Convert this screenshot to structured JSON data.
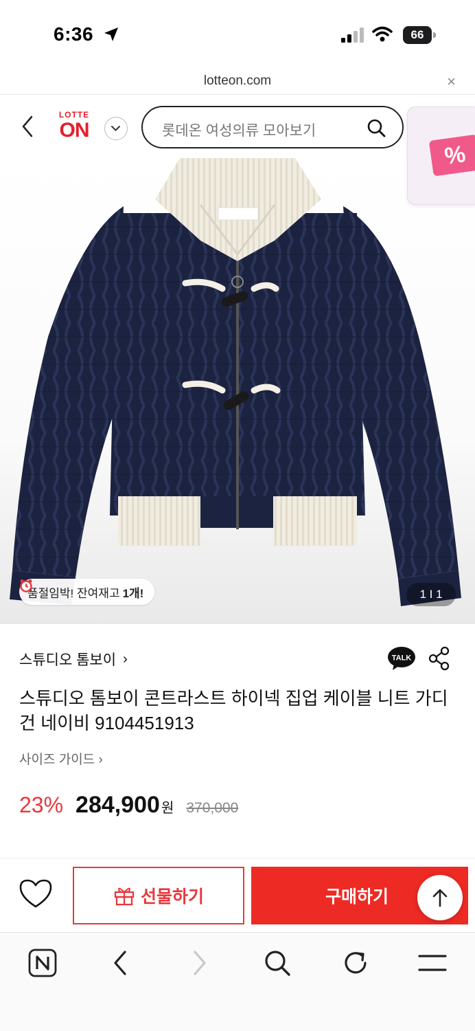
{
  "status_bar": {
    "time": "6:36",
    "battery": "66"
  },
  "browser": {
    "url": "lotteon.com",
    "close_label": "×"
  },
  "header": {
    "logo_top": "LOTTE",
    "logo_main": "ON",
    "search_placeholder": "롯데온 여성의류 모아보기",
    "promo_label": "%"
  },
  "image": {
    "stock_text": "품절임박! 잔여재고",
    "stock_count": "1개!",
    "page_counter": "1 I 1"
  },
  "product": {
    "brand": "스튜디오 톰보이",
    "brand_chevron": "›",
    "title": "스튜디오 톰보이 콘트라스트 하이넥 집업 케이블 니트 가디건 네이비 9104451913",
    "size_guide": "사이즈 가이드 ›",
    "discount": "23%",
    "price": "284,900",
    "currency": "원",
    "original_price": "370,000"
  },
  "actions": {
    "gift_label": "선물하기",
    "buy_label": "구매하기"
  },
  "talk_label": "TALK",
  "colors": {
    "accent_red": "#ee2a24",
    "discount_red": "#e8373c",
    "navy": "#1c2340",
    "ivory": "#f1ece0"
  },
  "icons": [
    "location-arrow-icon",
    "signal-icon",
    "wifi-icon",
    "battery-icon",
    "back-icon",
    "chevron-down-icon",
    "search-icon",
    "clock-icon",
    "talk-icon",
    "share-icon",
    "heart-icon",
    "gift-icon",
    "arrow-up-icon",
    "naver-icon",
    "back-nav-icon",
    "forward-nav-icon",
    "search-nav-icon",
    "refresh-icon",
    "menu-icon"
  ]
}
